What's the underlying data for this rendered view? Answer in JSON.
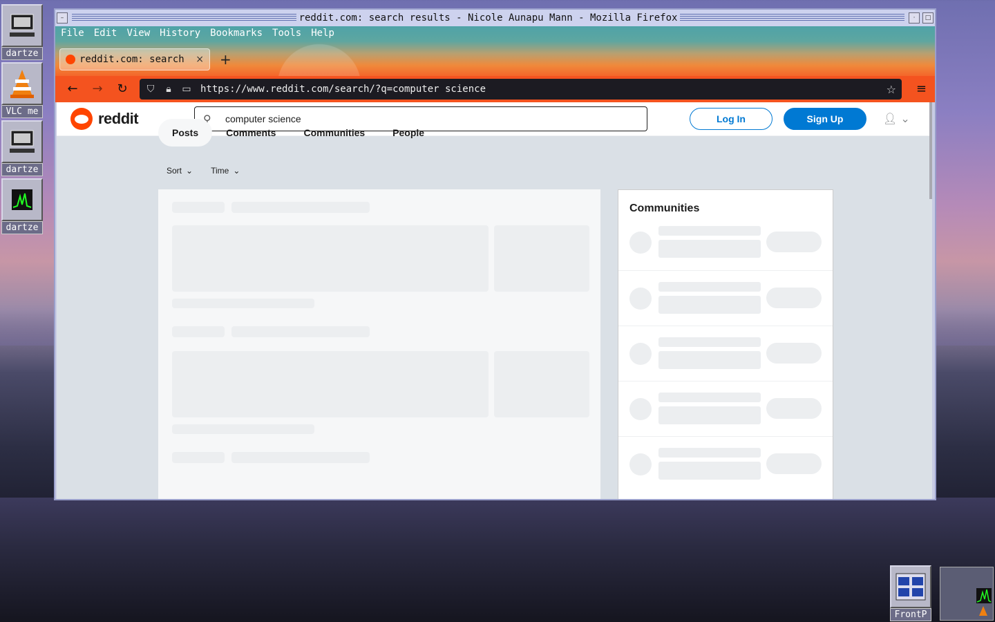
{
  "desktop": {
    "icons": [
      {
        "label": "dartze",
        "icon": "computer-icon"
      },
      {
        "label": "VLC me",
        "icon": "vlc-cone-icon"
      },
      {
        "label": "dartze",
        "icon": "computer-icon"
      },
      {
        "label": "dartze",
        "icon": "monitor-graph-icon"
      }
    ],
    "dock_label": "FrontP"
  },
  "window": {
    "title": "reddit.com: search results - Nicole Aunapu Mann - Mozilla Firefox"
  },
  "menubar": [
    "File",
    "Edit",
    "View",
    "History",
    "Bookmarks",
    "Tools",
    "Help"
  ],
  "tab": {
    "label": "reddit.com: search",
    "close": "×",
    "new_tab": "+"
  },
  "navbar": {
    "url": "https://www.reddit.com/search/?q=computer science"
  },
  "reddit": {
    "logo_text": "reddit",
    "search_value": "computer science",
    "login_label": "Log In",
    "signup_label": "Sign Up",
    "tabs": [
      "Posts",
      "Comments",
      "Communities",
      "People"
    ],
    "active_tab": "Posts",
    "sort_label": "Sort",
    "time_label": "Time",
    "sidebar_title": "Communities"
  },
  "colors": {
    "reddit_orange": "#ff4500",
    "reddit_blue": "#0079d3",
    "nav_orange": "#f4531f"
  }
}
